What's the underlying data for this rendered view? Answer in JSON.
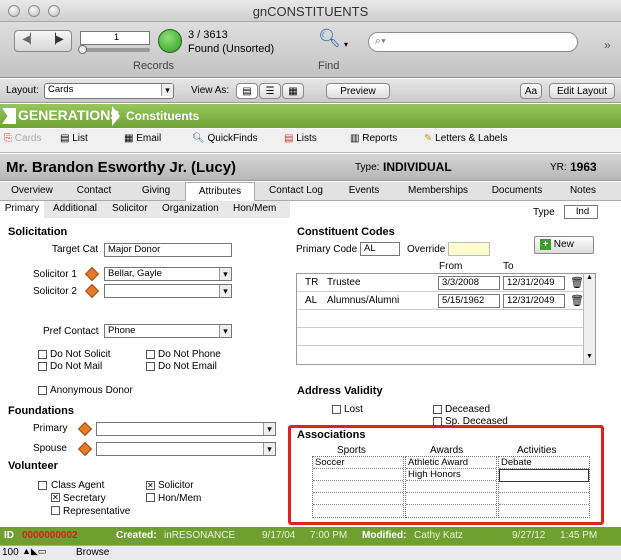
{
  "window": {
    "title": "gnCONSTITUENTS"
  },
  "toolbar": {
    "record_input": "1",
    "record_count": "3 / 3613",
    "found_status": "Found (Unsorted)",
    "records_label": "Records",
    "find_label": "Find",
    "search_placeholder": ""
  },
  "layoutbar": {
    "layout_label": "Layout:",
    "layout_value": "Cards",
    "view_as_label": "View As:",
    "preview_label": "Preview",
    "font_btn": "Aa",
    "edit_layout_label": "Edit Layout"
  },
  "brand": {
    "name": "GENERATIONS",
    "section": "Constituents"
  },
  "nav": [
    {
      "label": "Cards"
    },
    {
      "label": "List"
    },
    {
      "label": "Email"
    },
    {
      "label": "QuickFinds"
    },
    {
      "label": "Lists"
    },
    {
      "label": "Reports"
    },
    {
      "label": "Letters & Labels"
    }
  ],
  "record": {
    "name": "Mr. Brandon Esworthy Jr. (Lucy)",
    "type_label": "Type:",
    "type_value": "INDIVIDUAL",
    "yr_label": "YR:",
    "yr_value": "1963"
  },
  "tabs": [
    "Overview",
    "Contact",
    "Giving",
    "Attributes",
    "Contact Log",
    "Events",
    "Memberships",
    "Documents",
    "Notes"
  ],
  "subtabs": [
    "Primary",
    "Additional",
    "Solicitor",
    "Organization",
    "Hon/Mem"
  ],
  "type_field": {
    "label": "Type",
    "value": "Ind"
  },
  "solicitation": {
    "title": "Solicitation",
    "target_cat_label": "Target Cat",
    "target_cat_value": "Major Donor",
    "solicitor1_label": "Solicitor 1",
    "solicitor1_value": "Bellar, Gayle",
    "solicitor2_label": "Solicitor 2",
    "solicitor2_value": "",
    "pref_contact_label": "Pref Contact",
    "pref_contact_value": "Phone",
    "checks": [
      {
        "label": "Do Not Solicit",
        "checked": false
      },
      {
        "label": "Do Not Phone",
        "checked": false
      },
      {
        "label": "Do Not Mail",
        "checked": false
      },
      {
        "label": "Do Not Email",
        "checked": false
      },
      {
        "label": "Anonymous Donor",
        "checked": false
      }
    ]
  },
  "foundations": {
    "title": "Foundations",
    "primary_label": "Primary",
    "spouse_label": "Spouse"
  },
  "volunteer": {
    "title": "Volunteer",
    "checks": [
      {
        "label": "Class Agent",
        "checked": false
      },
      {
        "label": "Solicitor",
        "checked": true
      },
      {
        "label": "Secretary",
        "checked": true
      },
      {
        "label": "Hon/Mem",
        "checked": false
      },
      {
        "label": "Representative",
        "checked": false
      }
    ]
  },
  "codes": {
    "title": "Constituent Codes",
    "primary_code_label": "Primary Code",
    "primary_code_value": "AL",
    "override_label": "Override",
    "new_label": "New",
    "from_label": "From",
    "to_label": "To",
    "rows": [
      {
        "code": "TR",
        "desc": "Trustee",
        "from": "3/3/2008",
        "to": "12/31/2049"
      },
      {
        "code": "AL",
        "desc": "Alumnus/Alumni",
        "from": "5/15/1962",
        "to": "12/31/2049"
      }
    ]
  },
  "address": {
    "title": "Address Validity",
    "lost_label": "Lost",
    "deceased_label": "Deceased",
    "sp_deceased_label": "Sp. Deceased"
  },
  "associations": {
    "title": "Associations",
    "headers": [
      "Sports",
      "Awards",
      "Activities"
    ],
    "sports": [
      "Soccer",
      "",
      "",
      "",
      ""
    ],
    "awards": [
      "Athletic Award",
      "High Honors",
      "",
      "",
      ""
    ],
    "activities": [
      "Debate",
      "",
      "",
      "",
      ""
    ]
  },
  "status": {
    "id_label": "ID",
    "id_value": "0000000002",
    "created_label": "Created:",
    "created_by": "inRESONANCE",
    "created_date": "9/17/04",
    "created_time": "7:00 PM",
    "modified_label": "Modified:",
    "modified_by": "Cathy Katz",
    "modified_date": "9/27/12",
    "modified_time": "1:45 PM"
  },
  "bottom": {
    "zoom": "100",
    "mode": "Browse"
  },
  "colors": {
    "brand_green": "#6fa336",
    "highlight_red": "#e32020",
    "id_red": "#d21f1f"
  }
}
